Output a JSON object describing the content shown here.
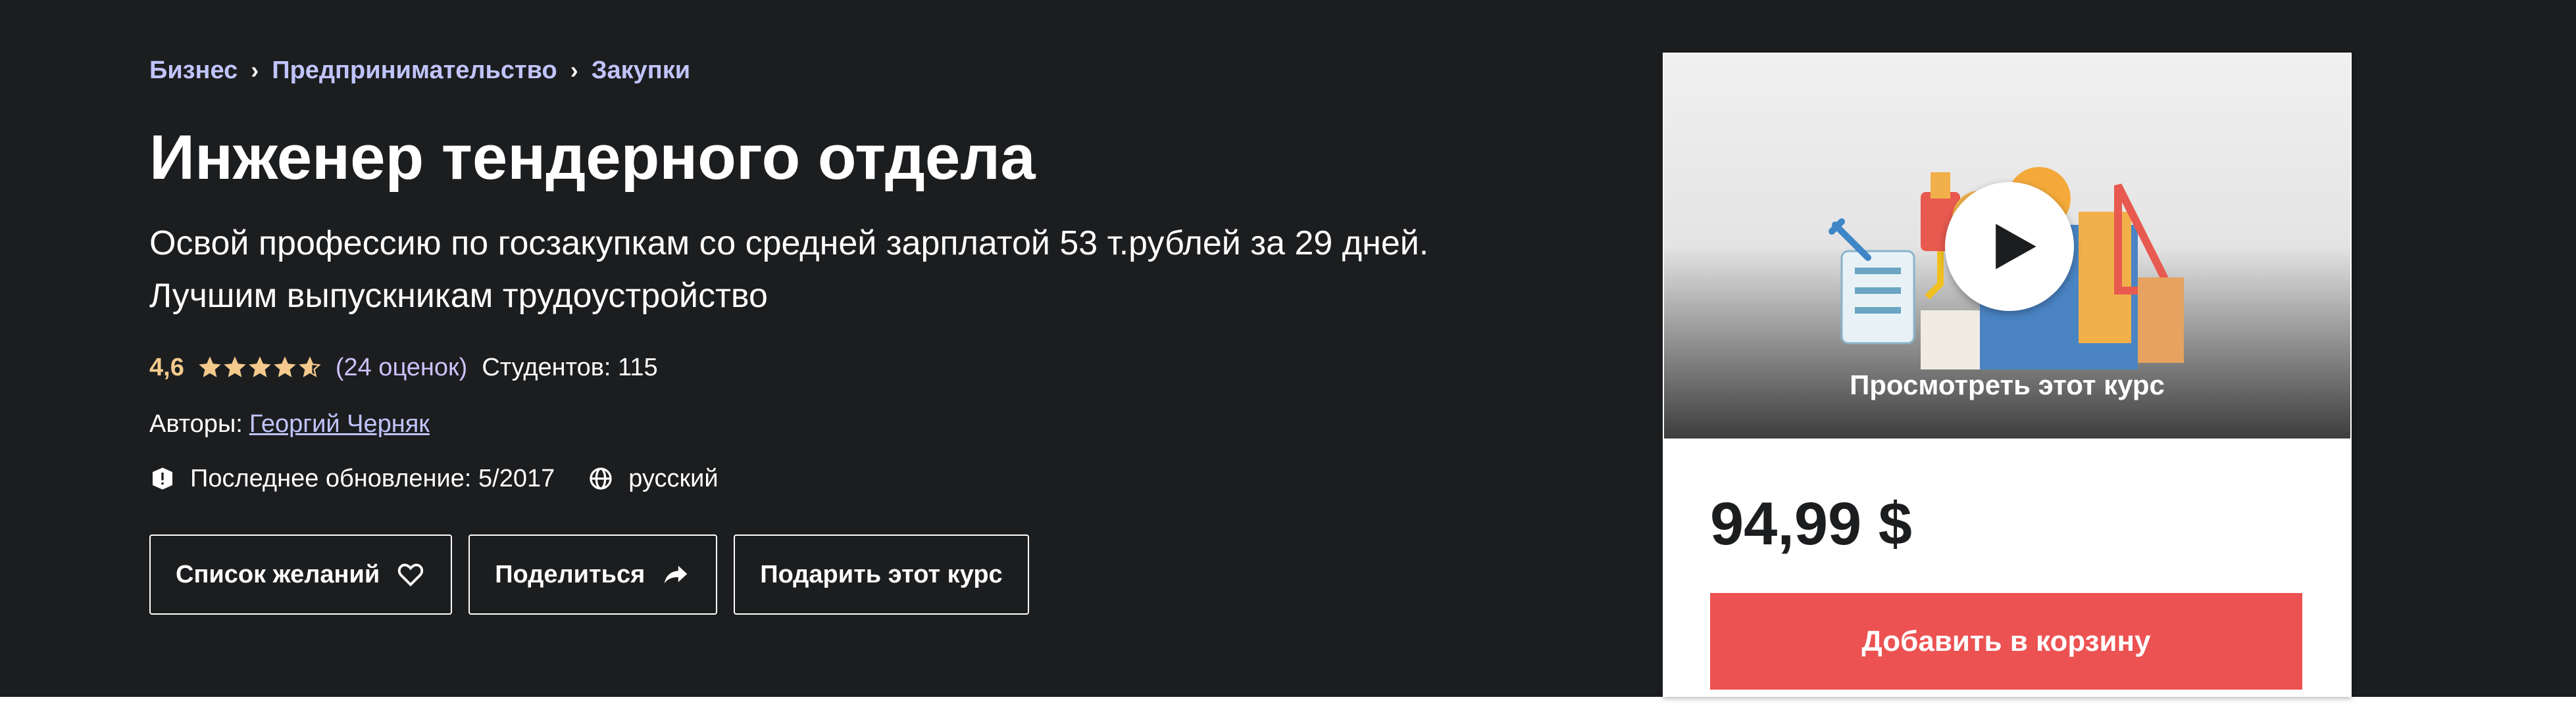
{
  "colors": {
    "background": "#1c1d1f",
    "link": "#c0c4fc",
    "rating": "#f3ca8c",
    "cart_button": "#ec5252"
  },
  "breadcrumb": [
    "Бизнес",
    "Предпринимательство",
    "Закупки"
  ],
  "course": {
    "title": "Инженер тендерного отдела",
    "subtitle": "Освой профессию по госзакупкам со средней зарплатой 53 т.рублей за 29 дней. Лучшим выпускникам трудоустройство",
    "rating_value": "4,6",
    "rating_stars": 4.6,
    "rating_count": "(24 оценок)",
    "students": "Студентов: 115",
    "authors_label": "Авторы:",
    "author_name": "Георгий Черняк",
    "last_update": "Последнее обновление: 5/2017",
    "language": "русский"
  },
  "actions": {
    "wishlist": "Список желаний",
    "share": "Поделиться",
    "gift": "Подарить этот курс"
  },
  "sidebar": {
    "preview_label": "Просмотреть этот курс",
    "price": "94,99 $",
    "add_to_cart": "Добавить в корзину"
  },
  "icons": {
    "star": "star-icon",
    "update": "alert-icon",
    "language": "globe-icon",
    "wishlist": "heart-icon",
    "share": "share-arrow-icon",
    "play": "play-icon"
  }
}
